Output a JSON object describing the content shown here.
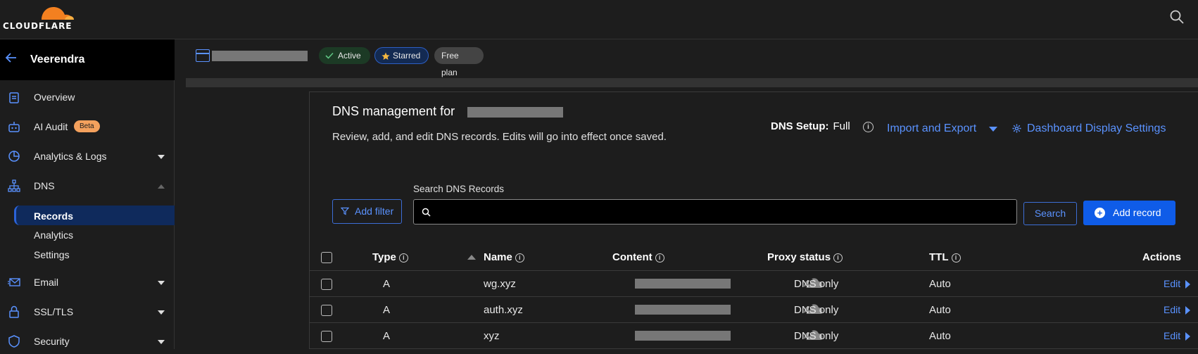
{
  "brand": {
    "logo_text": "CLOUDFLARE",
    "orange": "#f38020"
  },
  "sidebar": {
    "account_name": "Veerendra",
    "items": [
      {
        "label": "Overview",
        "icon": "clipboard-icon"
      },
      {
        "label": "AI Audit",
        "icon": "robot-icon",
        "badge": "Beta"
      },
      {
        "label": "Analytics & Logs",
        "icon": "pie-chart-icon"
      },
      {
        "label": "DNS",
        "icon": "network-icon"
      },
      {
        "label": "Email",
        "icon": "email-icon"
      },
      {
        "label": "SSL/TLS",
        "icon": "lock-icon"
      },
      {
        "label": "Security",
        "icon": "shield-icon"
      }
    ],
    "dns_sub": [
      {
        "label": "Records",
        "active": true
      },
      {
        "label": "Analytics"
      },
      {
        "label": "Settings"
      }
    ]
  },
  "zone": {
    "status": "Active",
    "starred": "Starred",
    "plan": "Free plan"
  },
  "main": {
    "title": "DNS management for",
    "description": "Review, add, and edit DNS records. Edits will go into effect once saved.",
    "setup_label": "DNS Setup:",
    "setup_value": "Full",
    "import_export": "Import and Export",
    "dashboard_settings": "Dashboard Display Settings",
    "search_label": "Search DNS Records",
    "search_placeholder": "",
    "add_filter": "Add filter",
    "search_button": "Search",
    "add_record": "Add record"
  },
  "table": {
    "headers": {
      "type": "Type",
      "name": "Name",
      "content": "Content",
      "proxy": "Proxy status",
      "ttl": "TTL",
      "actions": "Actions"
    },
    "rows": [
      {
        "type": "A",
        "name": "wg.xyz",
        "proxy": "DNS only",
        "ttl": "Auto",
        "action": "Edit"
      },
      {
        "type": "A",
        "name": "auth.xyz",
        "proxy": "DNS only",
        "ttl": "Auto",
        "action": "Edit"
      },
      {
        "type": "A",
        "name": "xyz",
        "proxy": "DNS only",
        "ttl": "Auto",
        "action": "Edit"
      }
    ]
  },
  "colors": {
    "accent": "#5a92ff",
    "primary_button": "#0f5ce8",
    "badge_beta": "#f4a15d"
  }
}
